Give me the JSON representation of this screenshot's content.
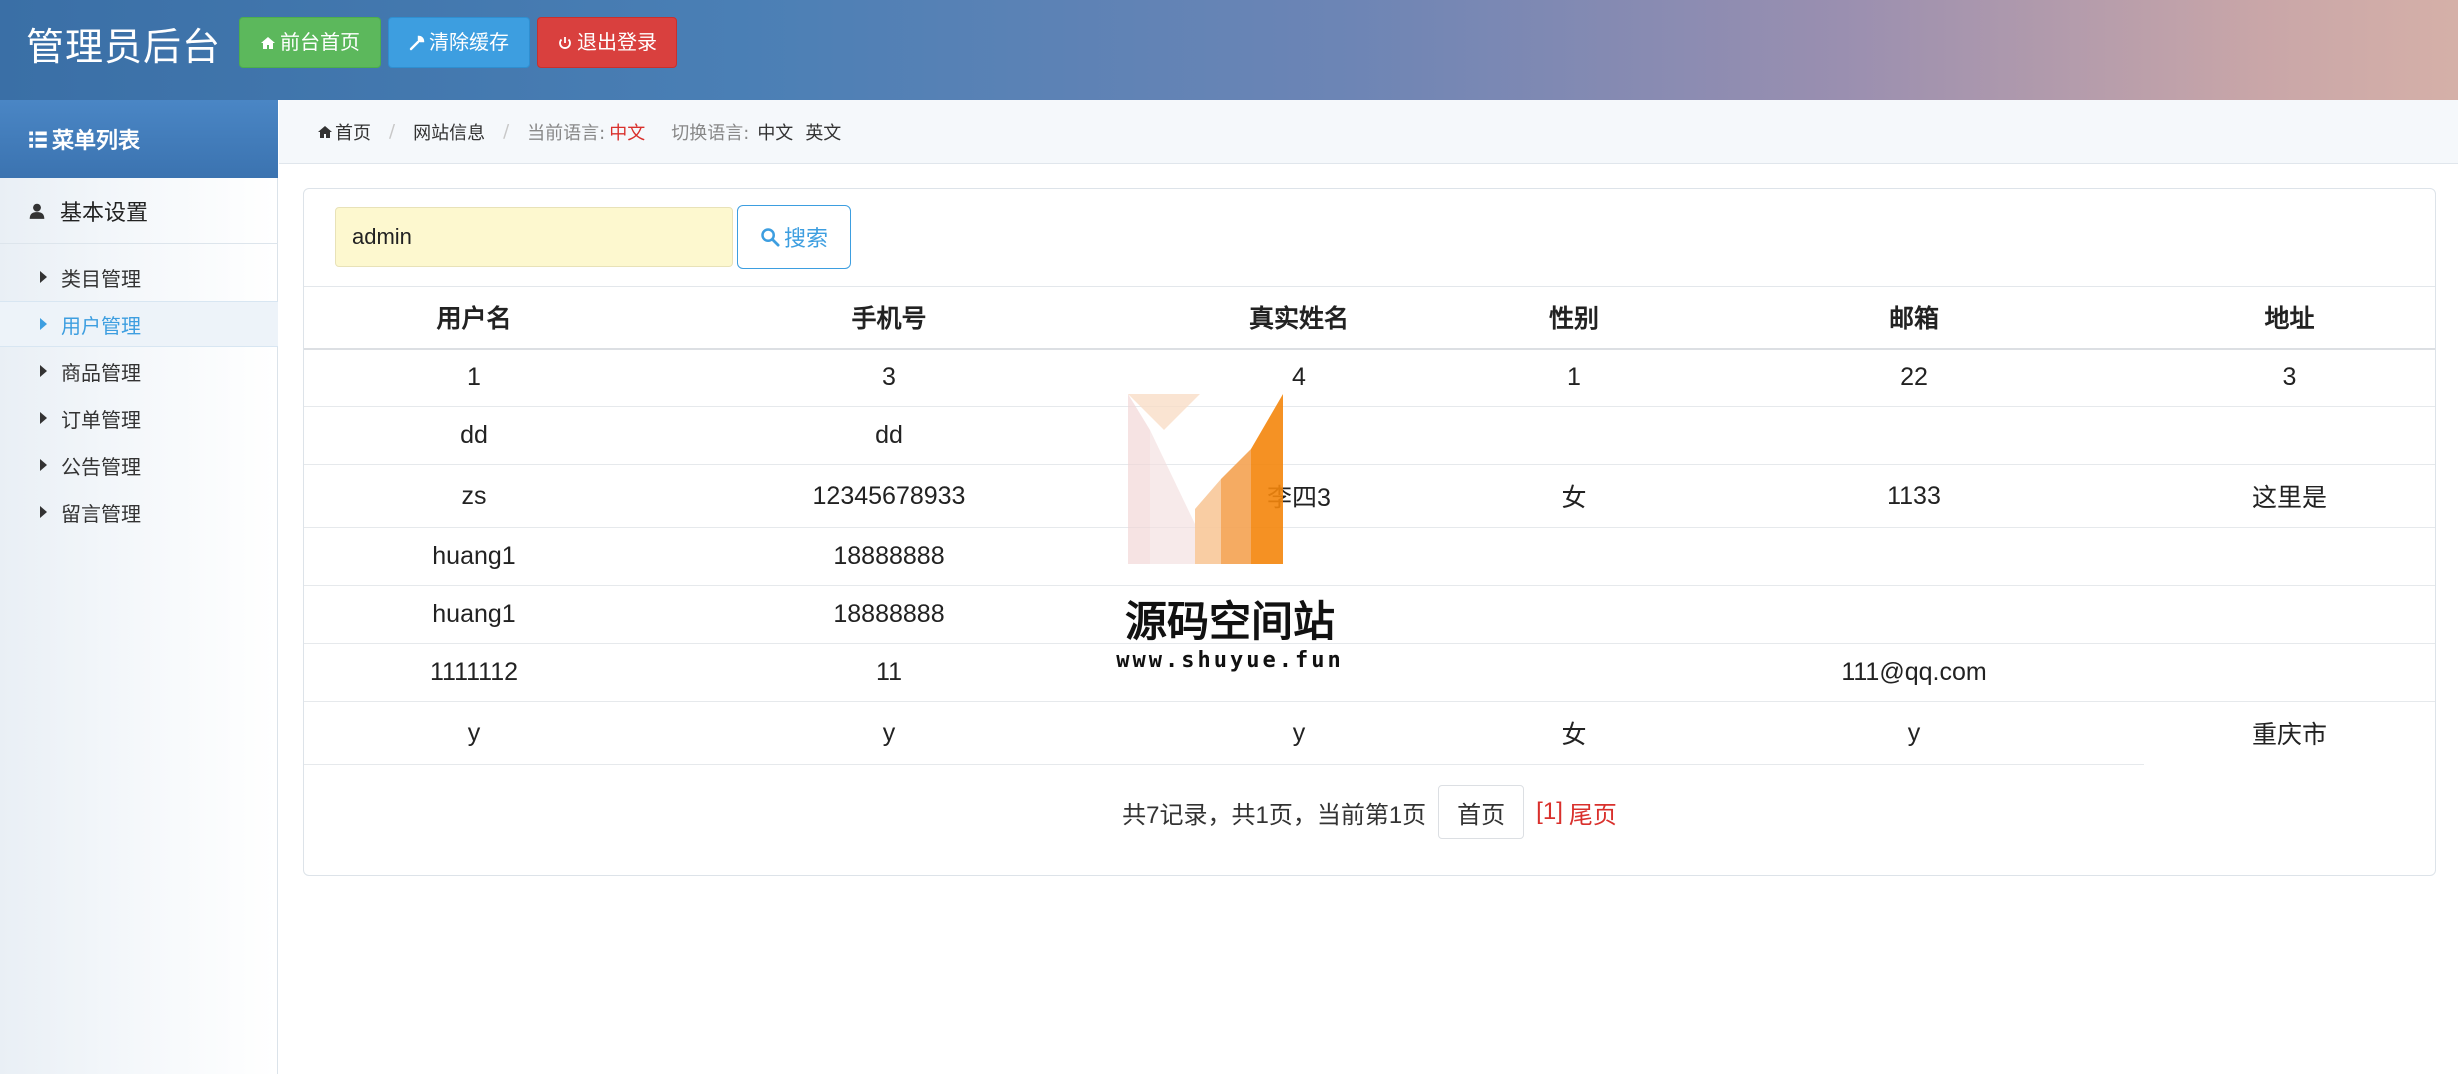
{
  "header": {
    "title": "管理员后台",
    "buttons": [
      {
        "label": "前台首页",
        "icon": "home-icon",
        "color": "#5cb85c"
      },
      {
        "label": "清除缓存",
        "icon": "wrench-icon",
        "color": "#3d9ee0"
      },
      {
        "label": "退出登录",
        "icon": "power-icon",
        "color": "#d9403e"
      }
    ]
  },
  "sidebar": {
    "heading": "菜单列表",
    "group": "基本设置",
    "items": [
      {
        "label": "类目管理",
        "active": false
      },
      {
        "label": "用户管理",
        "active": true
      },
      {
        "label": "商品管理",
        "active": false
      },
      {
        "label": "订单管理",
        "active": false
      },
      {
        "label": "公告管理",
        "active": false
      },
      {
        "label": "留言管理",
        "active": false
      }
    ]
  },
  "breadcrumb": {
    "home": "首页",
    "site_info": "网站信息",
    "current_lang_label": "当前语言:",
    "current_lang": "中文",
    "switch_lang_label": "切换语言:",
    "lang_zh": "中文",
    "lang_en": "英文"
  },
  "search": {
    "value": "admin",
    "button_label": "搜索"
  },
  "table": {
    "headers": [
      "用户名",
      "手机号",
      "真实姓名",
      "性别",
      "邮箱",
      "地址"
    ],
    "rows": [
      [
        "1",
        "3",
        "4",
        "1",
        "22",
        "3"
      ],
      [
        "dd",
        "dd",
        "",
        "",
        "",
        ""
      ],
      [
        "zs",
        "12345678933",
        "李四3",
        "女",
        "1133",
        "这里是"
      ],
      [
        "huang1",
        "18888888",
        "",
        "",
        "",
        ""
      ],
      [
        "huang1",
        "18888888",
        "",
        "",
        "",
        ""
      ],
      [
        "1111112",
        "11",
        "",
        "",
        "111@qq.com",
        ""
      ],
      [
        "y",
        "y",
        "y",
        "女",
        "y",
        "重庆市"
      ]
    ]
  },
  "pager": {
    "summary": "共7记录，共1页，当前第1页",
    "first": "首页",
    "current": "[1]",
    "last": "尾页"
  },
  "watermark": {
    "title": "源码空间站",
    "url": "www.shuyue.fun"
  },
  "colors": {
    "accent": "#3d9ee0",
    "danger": "#d9302c",
    "success": "#5cb85c",
    "search_bg": "#fdf8cf"
  }
}
